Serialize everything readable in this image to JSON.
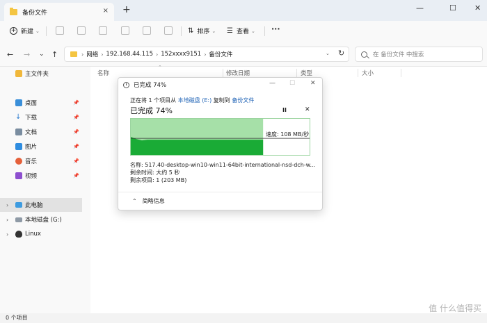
{
  "window": {
    "tab_title": "备份文件",
    "tab_close": "×",
    "new_tab": "+",
    "minimize": "—",
    "maximize": "☐",
    "close": "✕"
  },
  "toolbar": {
    "new_label": "新建",
    "sort_label": "排序",
    "view_label": "查看",
    "more_label": "···"
  },
  "address": {
    "crumbs": [
      "网络",
      "192.168.44.115",
      "152xxxx9151",
      "备份文件"
    ],
    "search_placeholder": "在 备份文件 中搜索"
  },
  "sidebar": {
    "items": [
      {
        "label": "主文件夹"
      },
      {
        "label": "桌面"
      },
      {
        "label": "下载"
      },
      {
        "label": "文档"
      },
      {
        "label": "图片"
      },
      {
        "label": "音乐"
      },
      {
        "label": "视频"
      },
      {
        "label": "此电脑"
      },
      {
        "label": "本地磁盘 (G:)"
      },
      {
        "label": "Linux"
      }
    ]
  },
  "columns": [
    "名称",
    "修改日期",
    "类型",
    "大小"
  ],
  "status": {
    "item_count": "0 个项目"
  },
  "dialog": {
    "title": "已完成 74%",
    "line_prefix": "正在将 1 个项目从 ",
    "source": "本地磁盘 (E:)",
    "line_mid": " 复制到 ",
    "dest": "备份文件",
    "heading": "已完成 74%",
    "pause": "II",
    "cancel": "✕",
    "speed": "速度: 108 MB/秒",
    "progress": 0.74,
    "name_line": "名称: 517.40-desktop-win10-win11-64bit-international-nsd-dch-w...",
    "time_line": "剩余时间: 大约 5 秒",
    "items_line": "剩余项目: 1 (203 MB)",
    "less_details": "简略信息",
    "colors": {
      "fill": "#1aab36",
      "light": "#a6e0a8"
    }
  },
  "watermark": "值 什么值得买"
}
